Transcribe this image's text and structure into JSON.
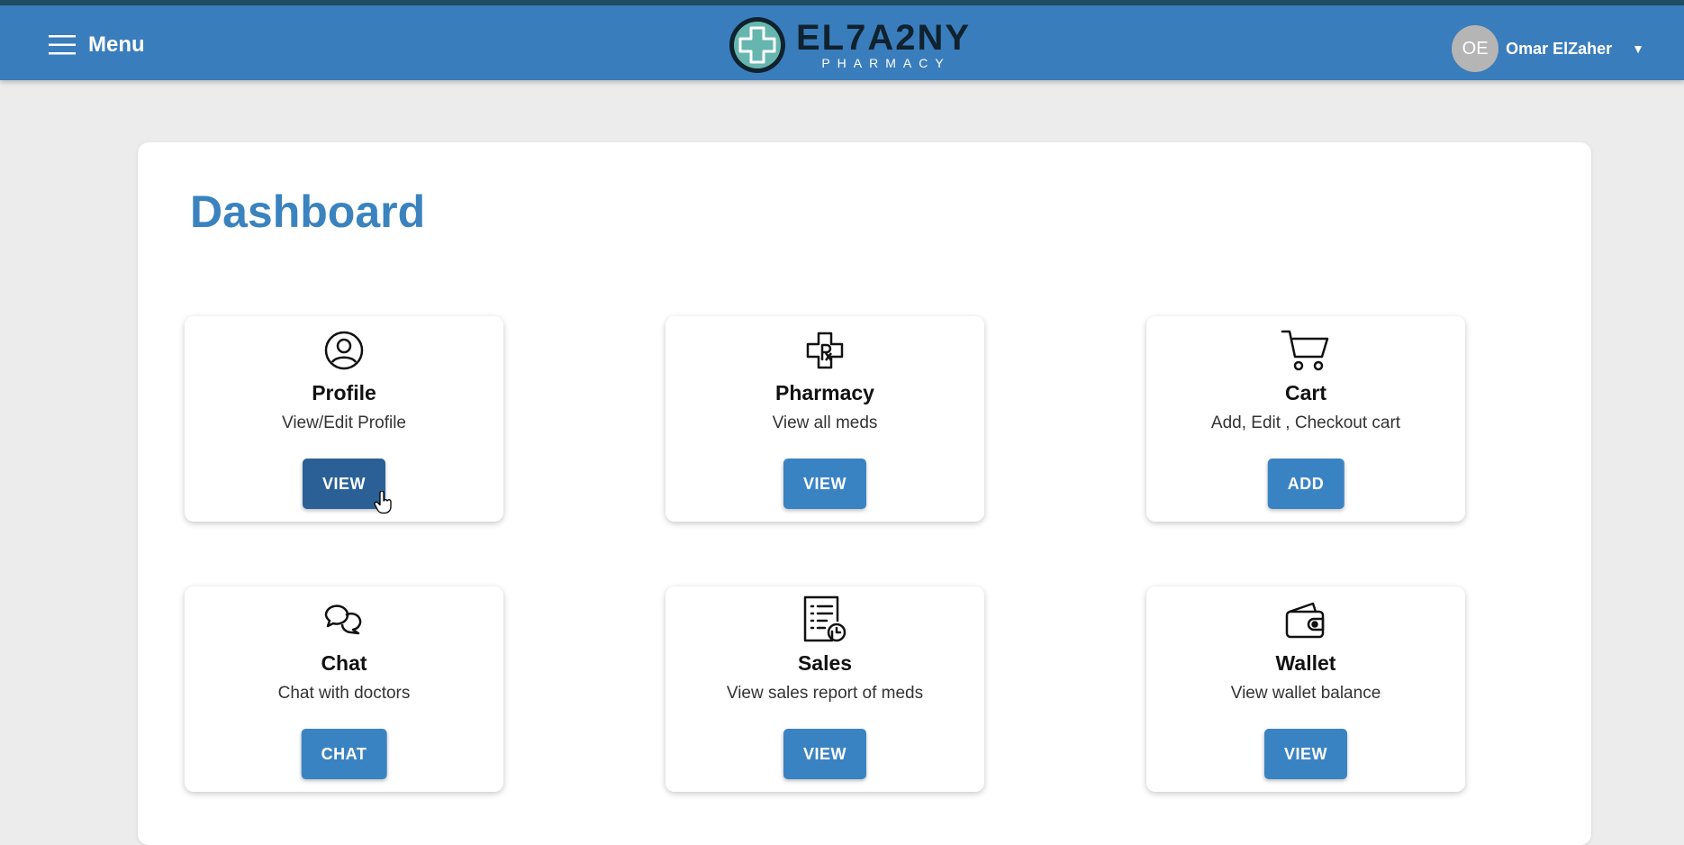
{
  "header": {
    "menu_label": "Menu",
    "brand_name": "EL7A2NY",
    "brand_sub": "PHARMACY",
    "user_initials": "OE",
    "user_name": "Omar ElZaher"
  },
  "page": {
    "title": "Dashboard"
  },
  "cards": [
    {
      "title": "Profile",
      "description": "View/Edit Profile",
      "button": "VIEW",
      "icon": "user-circle-icon"
    },
    {
      "title": "Pharmacy",
      "description": "View all meds",
      "button": "VIEW",
      "icon": "pharmacy-cross-icon"
    },
    {
      "title": "Cart",
      "description": "Add, Edit , Checkout cart",
      "button": "ADD",
      "icon": "cart-icon"
    },
    {
      "title": "Chat",
      "description": "Chat with doctors",
      "button": "CHAT",
      "icon": "chat-bubbles-icon"
    },
    {
      "title": "Sales",
      "description": "View sales report of meds",
      "button": "VIEW",
      "icon": "sales-report-icon"
    },
    {
      "title": "Wallet",
      "description": "View wallet balance",
      "button": "VIEW",
      "icon": "wallet-icon"
    }
  ],
  "colors": {
    "appbar": "#3a7dbc",
    "accent": "#3a83bf",
    "button": "#3a83c3",
    "button_active": "#2b6096"
  }
}
